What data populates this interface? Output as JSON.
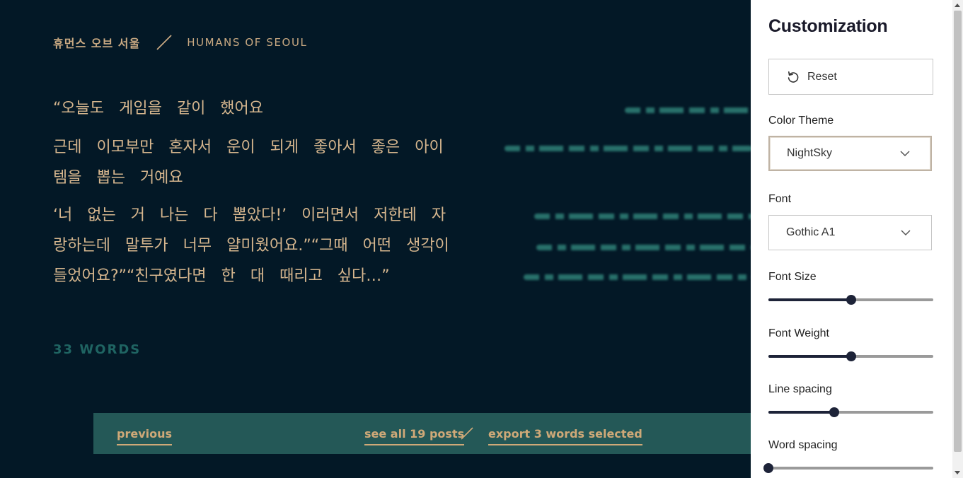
{
  "header": {
    "site_name_ko": "휴먼스 오브 서울",
    "site_name_en": "HUMANS OF SEOUL"
  },
  "post": {
    "paragraphs": [
      "“오늘도 게임을 같이 했어요",
      " 근데 이모부만 혼자서 운이 되게 좋아서 좋은 아이템을 뽑는 거예요",
      "‘너 없는 거 나는 다 뽑았다!’ 이러면서 저한테 자랑하는데 말투가 너무 얄미웠어요.”“그때 어떤 생각이 들었어요?”“친구였다면 한 대 때리고 싶다…”"
    ],
    "word_count": "33 WORDS"
  },
  "navigation": {
    "previous_label": "previous",
    "see_all_label": "see all 19 posts",
    "export_label": "export 3 words selected"
  },
  "customization": {
    "title": "Customization",
    "reset_label": "Reset",
    "color_theme_label": "Color Theme",
    "color_theme_value": "NightSky",
    "font_label": "Font",
    "font_value": "Gothic A1",
    "font_size_label": "Font Size",
    "font_size_fraction": 0.5,
    "font_weight_label": "Font Weight",
    "font_weight_fraction": 0.5,
    "line_spacing_label": "Line spacing",
    "line_spacing_fraction": 0.4,
    "word_spacing_label": "Word spacing",
    "word_spacing_fraction": 0.0
  },
  "colors": {
    "background": "#031826",
    "text": "#d6b68e",
    "accent_teal": "#245857",
    "word_count": "#1f6462",
    "slider": "#1d2338"
  }
}
